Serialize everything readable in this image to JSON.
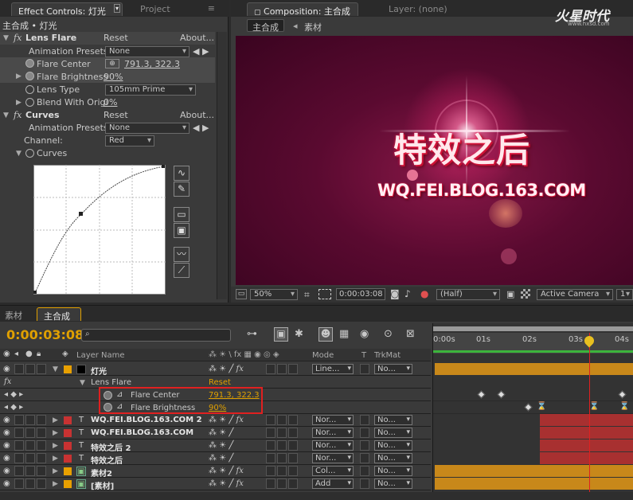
{
  "effect_controls": {
    "tab_label": "Effect Controls: 灯光",
    "project_tab": "Project",
    "breadcrumb": "主合成 • 灯光",
    "lens_flare": {
      "fx": "fx",
      "name": "Lens Flare",
      "reset": "Reset",
      "about": "About...",
      "presets_label": "Animation Presets:",
      "presets_value": "None",
      "flare_center_label": "Flare Center",
      "flare_center_value": "791.3, 322.3",
      "flare_brightness_label": "Flare Brightness",
      "flare_brightness_value": "90%",
      "lens_type_label": "Lens Type",
      "lens_type_value": "105mm Prime",
      "blend_label": "Blend With Origi",
      "blend_value": "0%"
    },
    "curves": {
      "fx": "fx",
      "name": "Curves",
      "reset": "Reset",
      "about": "About...",
      "presets_label": "Animation Presets:",
      "presets_value": "None",
      "channel_label": "Channel:",
      "channel_value": "Red",
      "curves_label": "Curves"
    }
  },
  "composition": {
    "tab_label": "Composition: 主合成",
    "layer_tab": "Layer: (none)",
    "sub_tabs": [
      "主合成",
      "素材"
    ],
    "logo_text": "火星时代",
    "logo_url": "www.hxsd.com",
    "preview_title": "特效之后",
    "preview_sub": "WQ.FEI.BLOG.163.COM",
    "zoom": "50%",
    "timecode": "0:00:03:08",
    "resolution": "(Half)",
    "camera": "Active Camera",
    "view": "1 V"
  },
  "timeline": {
    "tabs": [
      "素材",
      "主合成"
    ],
    "timecode": "0:00:03:08",
    "search_placeholder": "",
    "headers": {
      "layer_name": "Layer Name",
      "mode": "Mode",
      "t": "T",
      "trkmat": "TrkMat"
    },
    "ruler": [
      "0:00s",
      "01s",
      "02s",
      "03s",
      "04s"
    ],
    "layers": [
      {
        "name": "灯光",
        "color": "#e8a000",
        "type": "solid",
        "mode": "Line...",
        "trkmat": "No...",
        "fx": true
      },
      {
        "name": "WQ.FEI.BLOG.163.COM 2",
        "color": "#c83232",
        "type": "T",
        "mode": "Nor...",
        "trkmat": "No...",
        "fx": true
      },
      {
        "name": "WQ.FEI.BLOG.163.COM",
        "color": "#c83232",
        "type": "T",
        "mode": "Nor...",
        "trkmat": "No...",
        "fx": false
      },
      {
        "name": "特效之后 2",
        "color": "#c83232",
        "type": "T",
        "mode": "Nor...",
        "trkmat": "No...",
        "fx": false
      },
      {
        "name": "特效之后",
        "color": "#c83232",
        "type": "T",
        "mode": "Nor...",
        "trkmat": "No...",
        "fx": false
      },
      {
        "name": "素材2",
        "color": "#e8a000",
        "type": "comp",
        "mode": "Col...",
        "trkmat": "No...",
        "fx": true
      },
      {
        "name": "[素材]",
        "color": "#e8a000",
        "type": "comp",
        "mode": "Add",
        "trkmat": "No...",
        "fx": true
      }
    ],
    "lens_flare_row": {
      "label": "Lens Flare",
      "reset": "Reset"
    },
    "fc_row": {
      "label": "Flare Center",
      "value": "791.3, 322.3"
    },
    "fb_row": {
      "label": "Flare Brightness",
      "value": "90%"
    }
  },
  "colors": {
    "accent": "#e0a000",
    "highlight": "#e02020"
  }
}
